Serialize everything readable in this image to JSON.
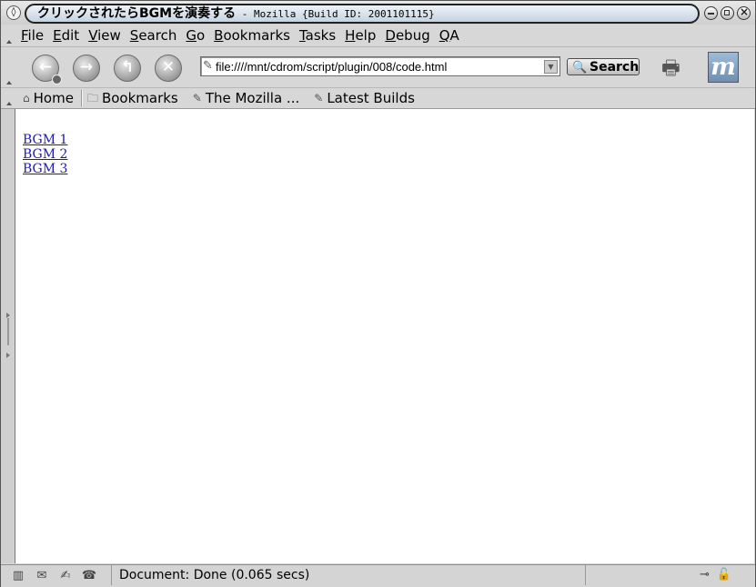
{
  "window": {
    "title_main": "クリックされたらBGMを演奏する",
    "title_sub": " - Mozilla {Build ID: 2001101115}"
  },
  "menubar": {
    "items": [
      {
        "mnemonic": "F",
        "rest": "ile"
      },
      {
        "mnemonic": "E",
        "rest": "dit"
      },
      {
        "mnemonic": "V",
        "rest": "iew"
      },
      {
        "mnemonic": "S",
        "rest": "earch"
      },
      {
        "mnemonic": "G",
        "rest": "o"
      },
      {
        "mnemonic": "B",
        "rest": "ookmarks"
      },
      {
        "mnemonic": "T",
        "rest": "asks"
      },
      {
        "mnemonic": "H",
        "rest": "elp"
      },
      {
        "mnemonic": "D",
        "rest": "ebug"
      },
      {
        "mnemonic": "Q",
        "rest": "A"
      }
    ]
  },
  "navbar": {
    "url": "file:////mnt/cdrom/script/plugin/008/code.html",
    "search_label": "Search"
  },
  "personal_toolbar": {
    "home": "Home",
    "bookmarks": "Bookmarks",
    "mozilla": "The Mozilla ...",
    "builds": "Latest Builds"
  },
  "content": {
    "links": [
      "BGM 1",
      "BGM 2",
      "BGM 3"
    ]
  },
  "status": {
    "text": "Document: Done (0.065 secs)"
  }
}
